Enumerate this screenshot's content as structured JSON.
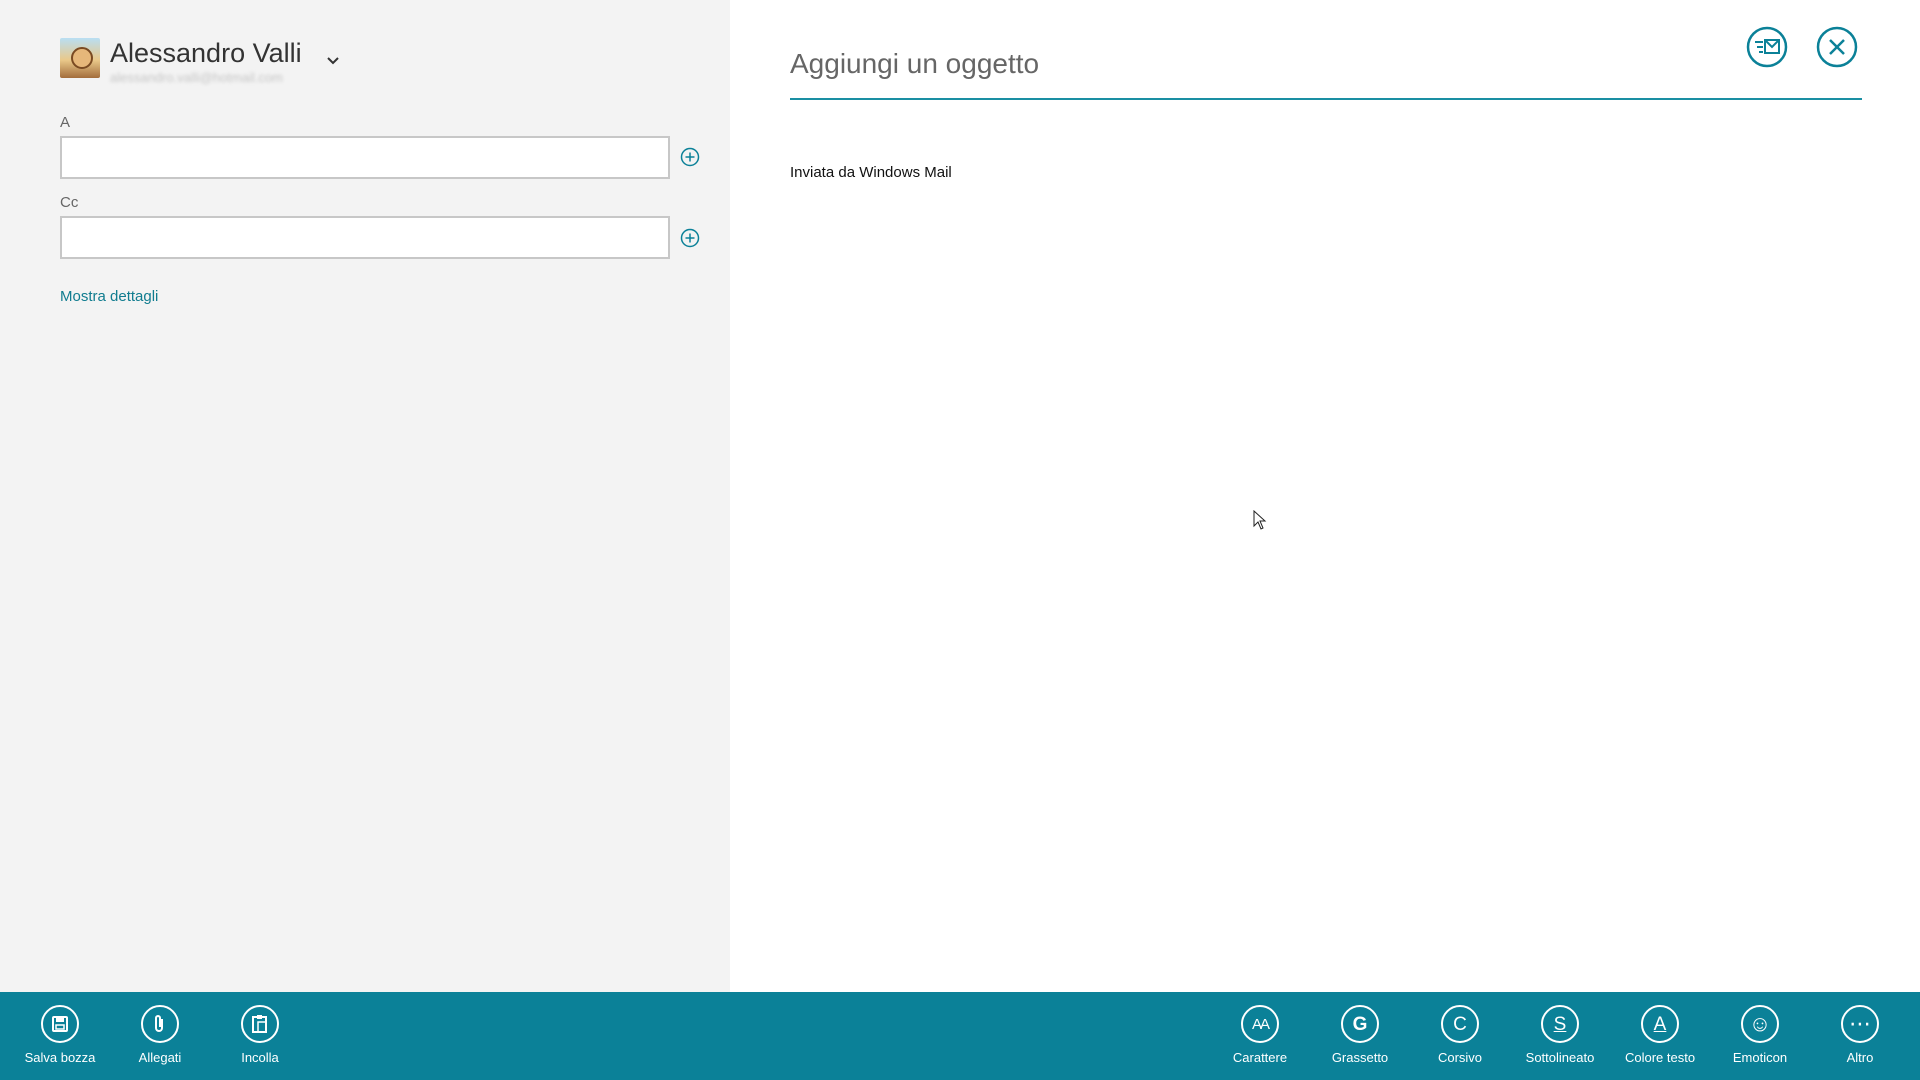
{
  "colors": {
    "accent": "#0b8198",
    "link": "#107c8f",
    "left_bg": "#f3f3f3"
  },
  "account": {
    "name": "Alessandro Valli",
    "email_blurred": "alessandro.valli@hotmail.com",
    "avatar_icon": "account-avatar"
  },
  "fields": {
    "to": {
      "label": "A",
      "value": ""
    },
    "cc": {
      "label": "Cc",
      "value": ""
    }
  },
  "details_link": "Mostra dettagli",
  "subject": {
    "placeholder": "Aggiungi un oggetto",
    "value": ""
  },
  "body": {
    "signature": "Inviata da Windows Mail"
  },
  "appbar": {
    "left": [
      {
        "label": "Salva bozza",
        "icon": "save-icon"
      },
      {
        "label": "Allegati",
        "icon": "paperclip-icon"
      },
      {
        "label": "Incolla",
        "icon": "paste-icon"
      }
    ],
    "right": [
      {
        "label": "Carattere",
        "icon": "font-icon",
        "glyph": "AA"
      },
      {
        "label": "Grassetto",
        "icon": "bold-icon",
        "glyph": "G"
      },
      {
        "label": "Corsivo",
        "icon": "italic-icon",
        "glyph": "C"
      },
      {
        "label": "Sottolineato",
        "icon": "underline-icon",
        "glyph": "S"
      },
      {
        "label": "Colore testo",
        "icon": "text-color-icon",
        "glyph": "A"
      },
      {
        "label": "Emoticon",
        "icon": "emoticon-icon",
        "glyph": "☺"
      },
      {
        "label": "Altro",
        "icon": "more-icon",
        "glyph": "⋯"
      }
    ]
  }
}
